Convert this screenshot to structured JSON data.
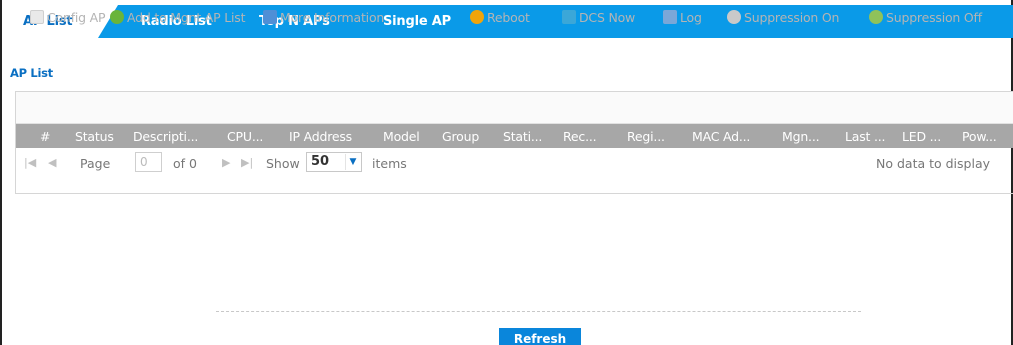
{
  "tabs": [
    {
      "label": "AP List"
    },
    {
      "label": "Radio List"
    },
    {
      "label": "Top N APs"
    },
    {
      "label": "Single AP"
    }
  ],
  "section_title": "AP List",
  "toolbar": {
    "items": [
      {
        "label": "Config AP",
        "icon": "edit-icon"
      },
      {
        "label": "Add to Mgnt AP List",
        "icon": "add-icon"
      },
      {
        "label": "More Information",
        "icon": "info-window-icon"
      },
      {
        "label": "Reboot",
        "icon": "power-icon"
      },
      {
        "label": "DCS Now",
        "icon": "dcs-icon"
      },
      {
        "label": "Log",
        "icon": "log-icon"
      },
      {
        "label": "Suppression On",
        "icon": "suppression-on-icon"
      },
      {
        "label": "Suppression Off",
        "icon": "suppression-off-icon"
      }
    ]
  },
  "table": {
    "columns": [
      "#",
      "Status",
      "Descripti...",
      "CPU...",
      "IP Address",
      "Model",
      "Group",
      "Stati...",
      "Rec...",
      "Regi...",
      "MAC Ad...",
      "Mgn...",
      "Last ...",
      "LED ...",
      "Pow..."
    ]
  },
  "pager": {
    "page_label": "Page",
    "page_value": "0",
    "of_label": "of 0",
    "show_label": "Show",
    "show_value": "50",
    "items_label": "items",
    "empty_text": "No data to display"
  },
  "refresh_label": "Refresh",
  "colors": {
    "accent": "#0a9ae8",
    "tab_active_text": "#0a6fc2",
    "header_bg": "#a7a7a7",
    "button_bg": "#0a86db"
  }
}
